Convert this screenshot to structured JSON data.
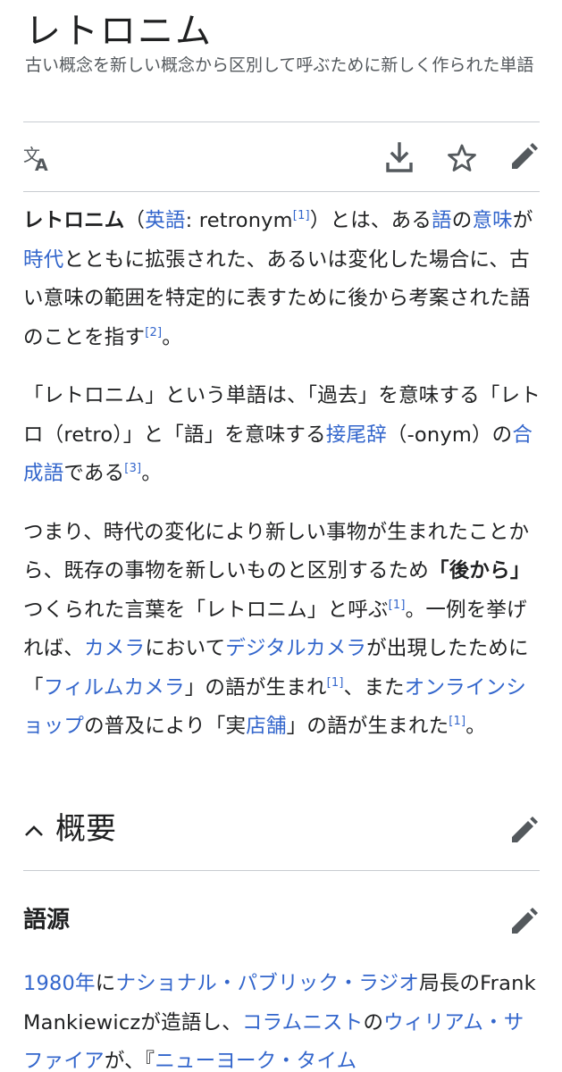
{
  "page": {
    "title": "レトロニム",
    "subtitle": "古い概念を新しい概念から区別して呼ぶために新しく作られた単語"
  },
  "toolbar": {
    "language_icon": "translate-icon",
    "download_icon": "download-icon",
    "watch_icon": "star-icon",
    "edit_icon": "pencil-icon"
  },
  "article": {
    "p1": {
      "bold": "レトロニム",
      "paren_open": "（",
      "link_eigo": "英語",
      "eng": ": retronym",
      "ref1": "[1]",
      "paren_close": "）",
      "t1": "とは、ある",
      "link_go": "語",
      "t2": "の",
      "link_imi": "意味",
      "t3": "が",
      "link_jidai": "時代",
      "t4": "とともに拡張された、あるいは変化した場合に、古い意味の範囲を特定的に表すために後から考案された語のことを指す",
      "ref2": "[2]",
      "t5": "。"
    },
    "p2": {
      "t1": "「レトロニム」という単語は、「過去」を意味する「レトロ（retro）」と「語」を意味する",
      "link_setsubiji": "接尾辞",
      "t2": "（-onym）の",
      "link_goseigo": "合成語",
      "t3": "である",
      "ref3": "[3]",
      "t4": "。"
    },
    "p3": {
      "t1": "つまり、時代の変化により新しい事物が生まれたことから、既存の事物を新しいものと区別するため",
      "bold": "「後から」",
      "t2": "つくられた言葉を「レトロニム」と呼ぶ",
      "ref1": "[1]",
      "t3": "。一例を挙げれば、",
      "link_camera": "カメラ",
      "t4": "において",
      "link_digital": "デジタルカメラ",
      "t5": "が出現したために「",
      "link_film": "フィルムカメラ",
      "t6": "」の語が生まれ",
      "ref2": "[1]",
      "t7": "、また",
      "link_online": "オンラインショップ",
      "t8": "の普及により「実",
      "link_tenpo": "店舗",
      "t9": "」の語が生まれた",
      "ref3": "[1]",
      "t10": "。"
    }
  },
  "section_overview": {
    "chevron_icon": "chevron-up-icon",
    "title": "概要",
    "edit_icon": "pencil-icon"
  },
  "subsection_etymology": {
    "title": "語源",
    "edit_icon": "pencil-icon"
  },
  "etymology": {
    "link_1980": "1980年",
    "t1": "に",
    "link_npr": "ナショナル・パブリック・ラジオ",
    "t2": "局長のFrank Mankiewiczが造語し、",
    "link_columnist": "コラムニスト",
    "t3": "の",
    "link_safire": "ウィリアム・サファイア",
    "t4": "が、『",
    "link_nyt": "ニューヨーク・タイム"
  },
  "colors": {
    "link": "#3366cc",
    "text": "#202122",
    "subtle": "#54595d",
    "divider": "#c8ccd1"
  }
}
